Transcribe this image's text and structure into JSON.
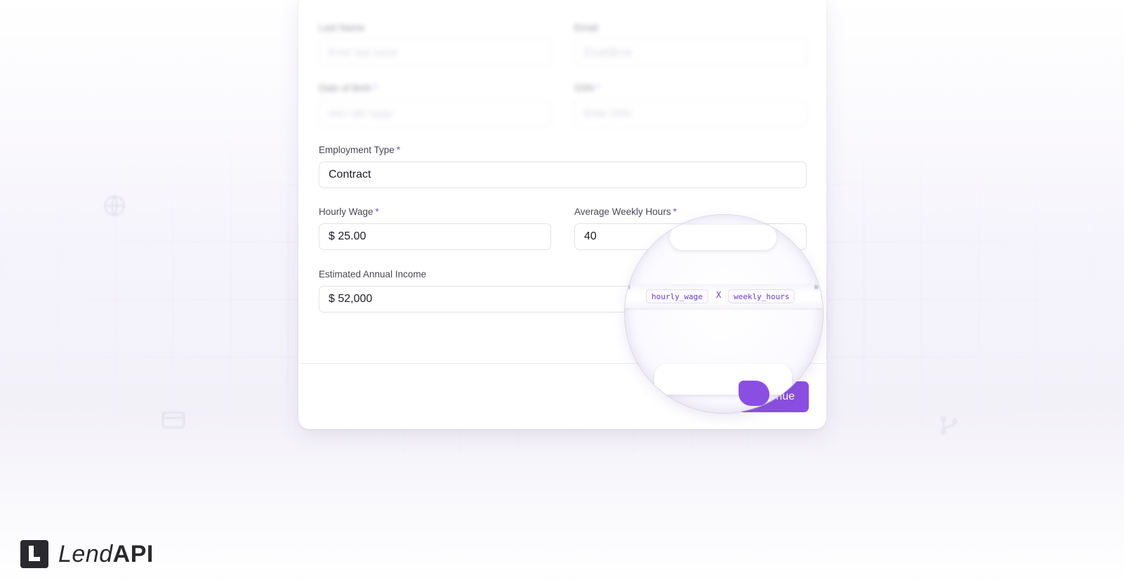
{
  "form": {
    "blurred": {
      "row1": {
        "left_label": "Last Name",
        "left_placeholder": "Enter last name",
        "right_label": "Email",
        "right_placeholder": "Email@me"
      },
      "row2": {
        "left_label": "Date of Birth",
        "left_placeholder": "mm / dd / yyyy",
        "right_label": "SSN",
        "right_placeholder": "Enter SSN"
      }
    },
    "employment_type": {
      "label": "Employment Type",
      "value": "Contract"
    },
    "hourly_wage": {
      "label": "Hourly Wage",
      "value": "$ 25.00"
    },
    "weekly_hours": {
      "label": "Average Weekly Hours",
      "value": "40"
    },
    "annual_income": {
      "label": "Estimated Annual Income",
      "value": "$ 52,000"
    },
    "required_mark": "*",
    "continue_label": "nue"
  },
  "formula": {
    "left": "hourly_wage",
    "operator": "X",
    "right": "weekly_hours"
  },
  "brand": {
    "name_light": "Lend",
    "name_bold": "API"
  },
  "colors": {
    "accent": "#8a4fe0",
    "label": "#4a4757",
    "background": "#f5f3fb"
  },
  "icons": [
    "globe-icon",
    "card-icon",
    "git-branch-icon"
  ]
}
